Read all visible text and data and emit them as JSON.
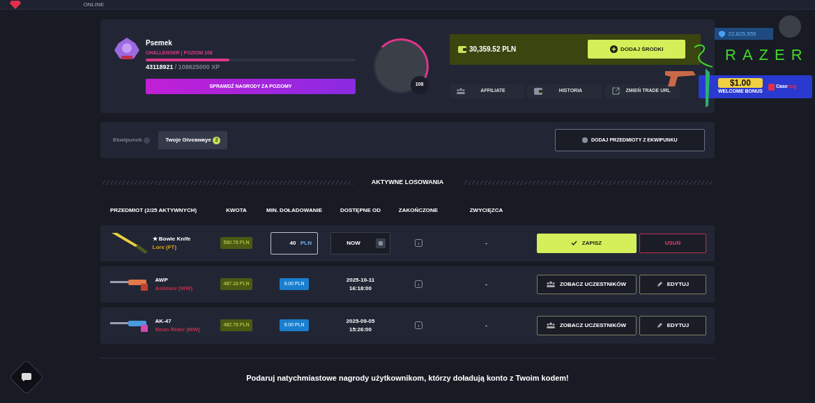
{
  "top_bar": {
    "status": "ONLINE"
  },
  "profile": {
    "username": "Psemek",
    "rank": "CHALLENGER | POZIOM 108",
    "xp_current": "43118921",
    "xp_total": "/ 108625000 XP",
    "level": 0.4,
    "rewards_button": "SPRAWDŹ NAGRODY ZA POZIOMY",
    "avatar_level": "108"
  },
  "wallet": {
    "balance": "30,359.52 PLN",
    "deposit_button": "DODAJ ŚRODKI"
  },
  "profile_links": [
    {
      "label": "AFFILIATE"
    },
    {
      "label": "HISTORIA"
    },
    {
      "label": "ZMIEŃ TRADE URL"
    }
  ],
  "tabs": [
    {
      "label": "Ekwipunek",
      "selected": false
    },
    {
      "label": "Twoje Giveawaye",
      "selected": true,
      "count": "2"
    }
  ],
  "add_items_button": "DODAJ PRZEDMIOTY Z EKWIPUNKU",
  "section_title": "AKTYWNE LOSOWANIA",
  "table": {
    "columns": [
      "PRZEDMIOT (2/25 AKTYWNYCH)",
      "KWOTA",
      "MIN. DOŁADOWANIE",
      "DOSTĘPNE OD",
      "ZAKOŃCZONE",
      "ZWYCIĘZCA"
    ],
    "rows": [
      {
        "kind": "editing",
        "name": "★ Bowie Knife",
        "skin": "Lore (FT)",
        "color": "#d9a520",
        "price": "560.76 PLN",
        "min_deposit": "40",
        "currency": "PLN",
        "available_from": [
          "NOW"
        ],
        "winner": "-",
        "buttons": [
          "ZAPISZ",
          "USUŃ"
        ]
      },
      {
        "kind": "view",
        "name": "AWP",
        "skin": "Asiimov (WW)",
        "color": "#c0304a",
        "price": "487.16 PLN",
        "min_deposit": "9.00 PLN",
        "available_from": [
          "2025-10-11",
          "16:18:00"
        ],
        "winner": "-",
        "buttons": [
          "ZOBACZ UCZESTNIKÓW",
          "EDYTUJ"
        ]
      },
      {
        "kind": "view",
        "name": "AK-47",
        "skin": "Neon Rider (MW)",
        "color": "#c0304a",
        "price": "482.76 PLN",
        "min_deposit": "9.00 PLN",
        "available_from": [
          "2025-09-05",
          "15:26:00"
        ],
        "winner": "-",
        "buttons": [
          "ZOBACZ UCZESTNIKÓW",
          "EDYTUJ"
        ]
      }
    ]
  },
  "footer_text": "Podaruj natychmiastowe nagrody użytkownikom, którzy doładują konto z Twoim kodem!",
  "stream_overlay": {
    "viewer_count": "22,825,555",
    "sponsor": "RAZER",
    "bonus_amount": "$1.00",
    "bonus_label": "WELCOME BONUS",
    "brand": [
      "Case",
      "hug"
    ]
  }
}
